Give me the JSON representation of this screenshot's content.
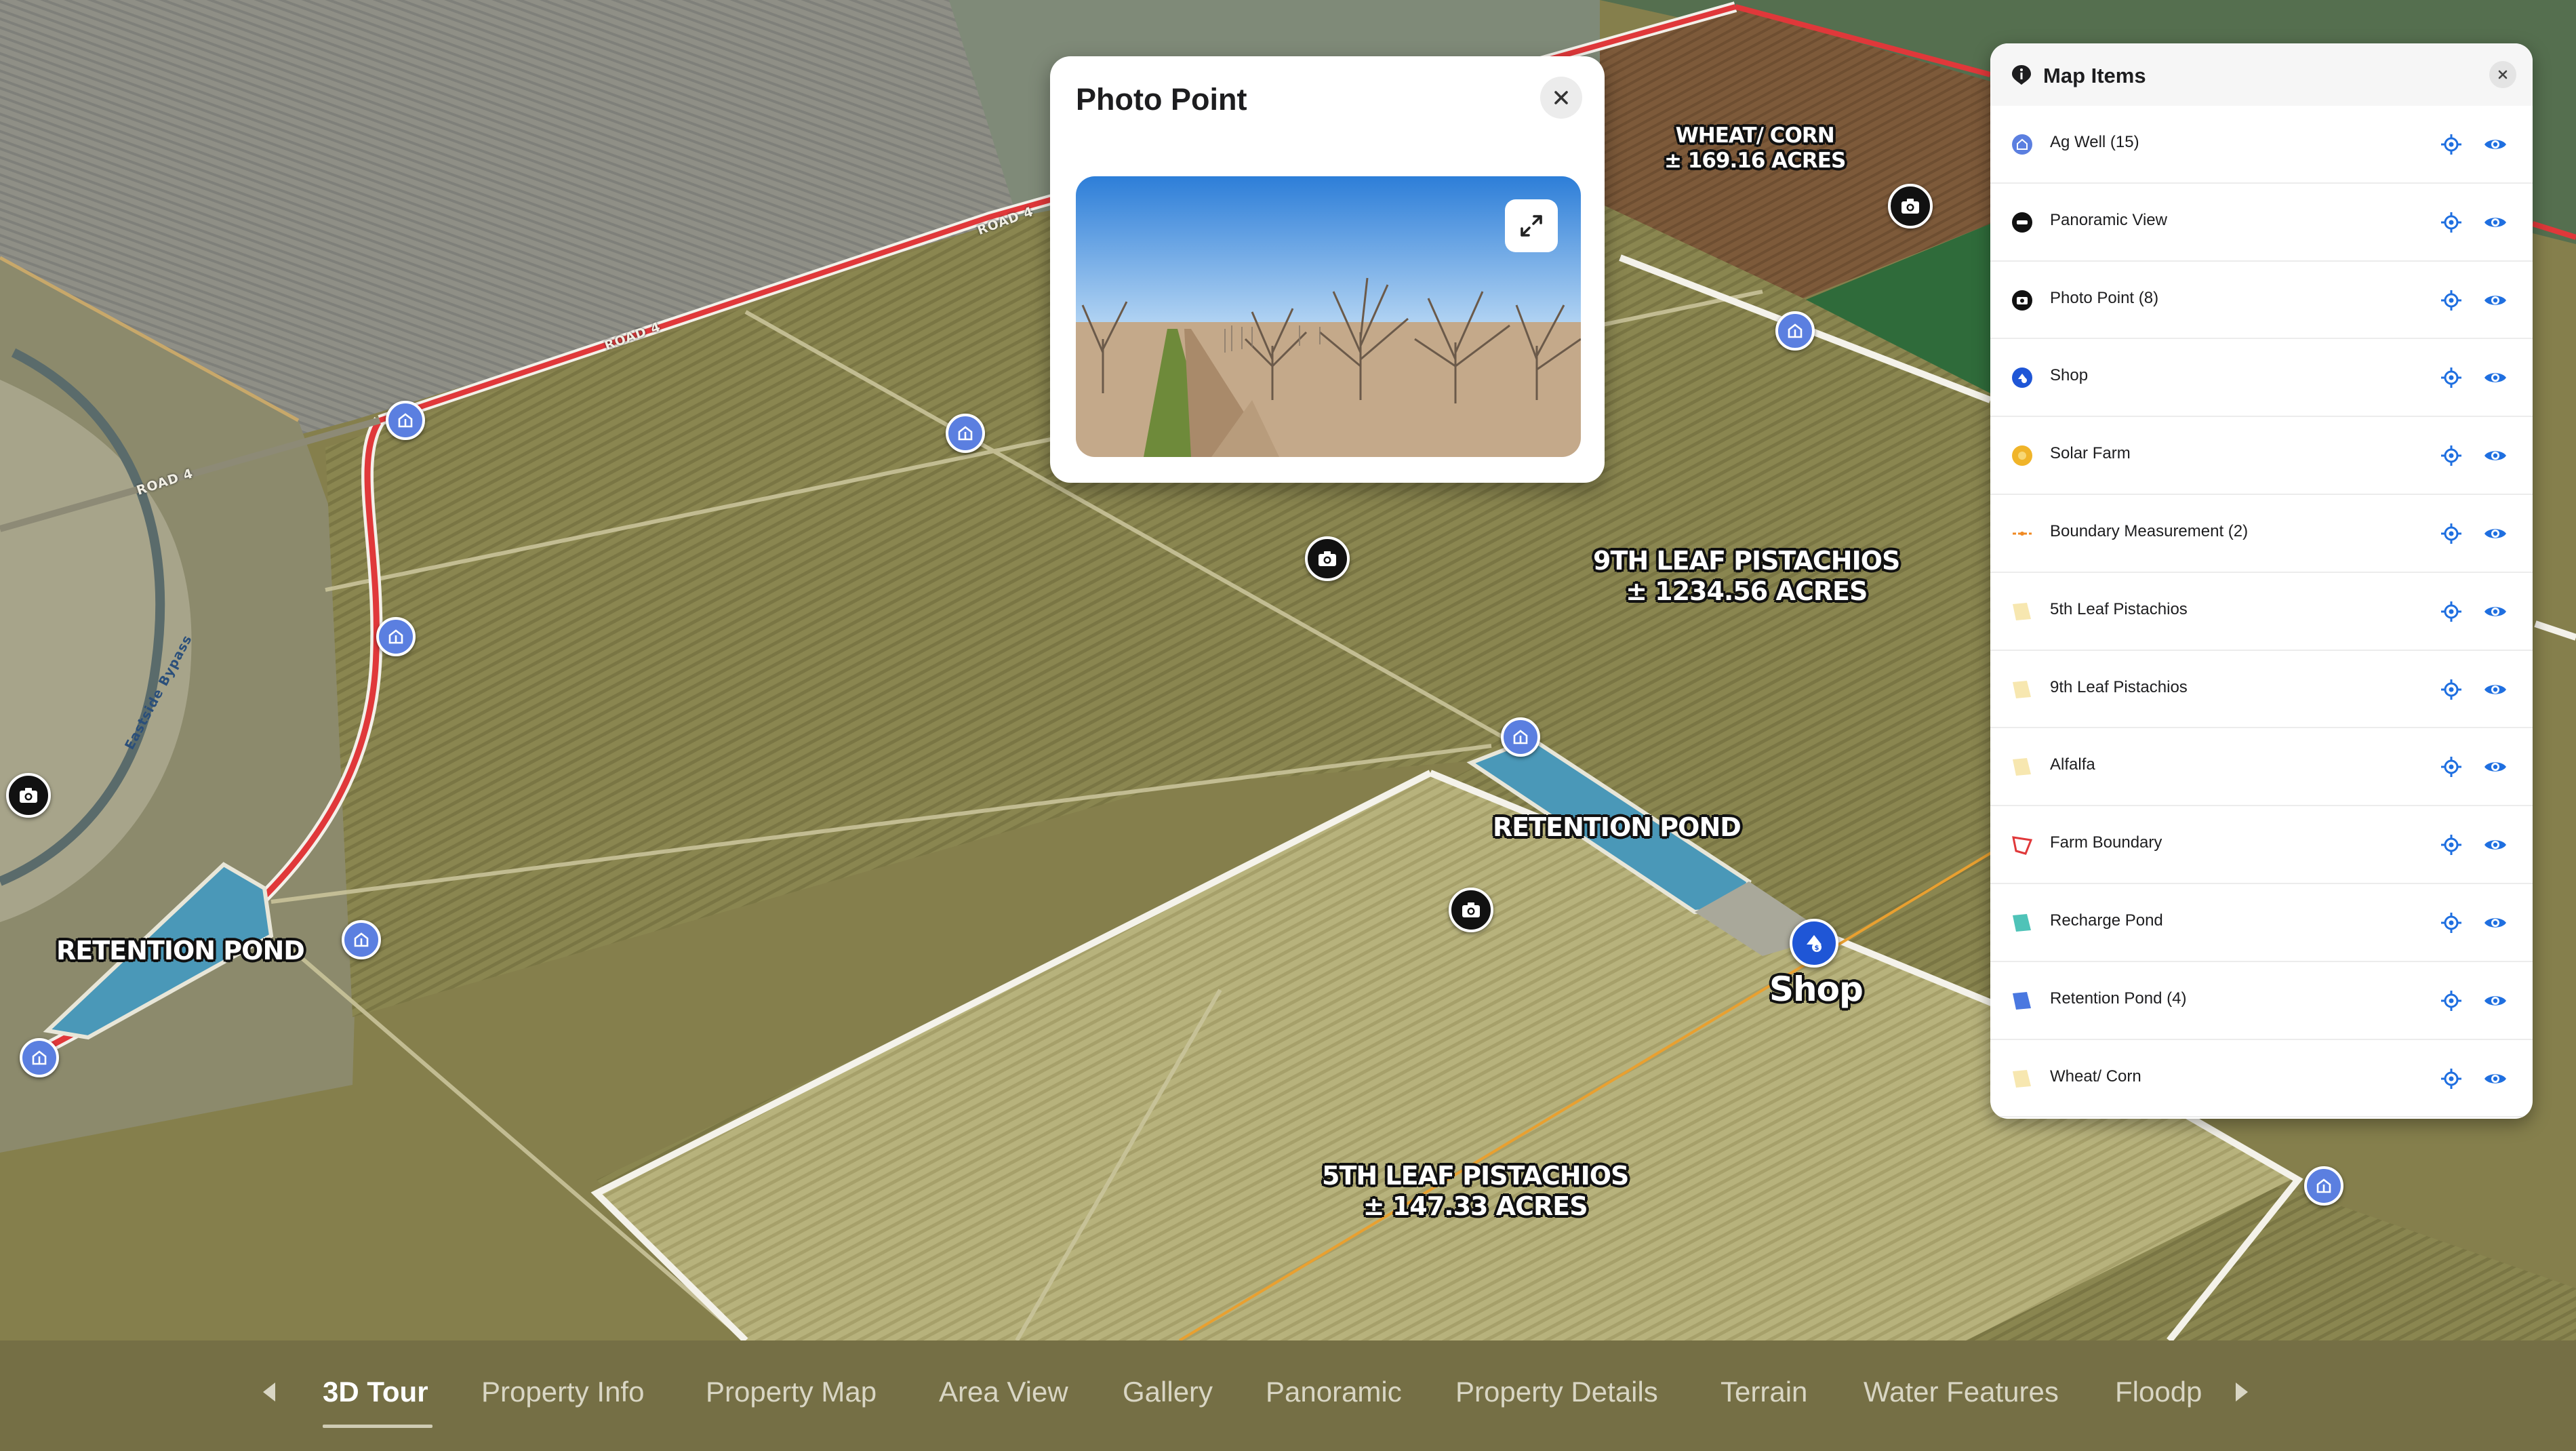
{
  "map": {
    "labels": {
      "wheat_corn_name": "WHEAT/ CORN",
      "wheat_corn_acres": "± 169.16 ACRES",
      "ninth_leaf_name": "9TH LEAF PISTACHIOS",
      "ninth_leaf_acres": "± 1234.56 ACRES",
      "fifth_leaf_name": "5TH LEAF PISTACHIOS",
      "fifth_leaf_acres": "± 147.33 ACRES",
      "retention_pond_center": "RETENTION POND",
      "retention_pond_left": "RETENTION POND",
      "shop": "Shop",
      "road_a": "ROAD 4",
      "road_b": "ROAD 4",
      "road_c": "ROAD 4",
      "bypass": "Eastside Bypass"
    }
  },
  "popup": {
    "title": "Photo Point"
  },
  "panel": {
    "title": "Map Items",
    "items": [
      {
        "label": "Ag Well (15)",
        "icon": "ag-well-icon",
        "color": "#5b7fe0"
      },
      {
        "label": "Panoramic View",
        "icon": "panoramic-icon",
        "color": "#111111"
      },
      {
        "label": "Photo Point (8)",
        "icon": "camera-icon",
        "color": "#111111"
      },
      {
        "label": "Shop",
        "icon": "shop-icon",
        "color": "#1f56d6"
      },
      {
        "label": "Solar Farm",
        "icon": "solar-icon",
        "color": "#f0b429"
      },
      {
        "label": "Boundary Measurement (2)",
        "icon": "measure-icon",
        "color": "#f08a24"
      },
      {
        "label": "5th Leaf Pistachios",
        "icon": "polygon-icon",
        "color": "#f7e7b0"
      },
      {
        "label": "9th Leaf Pistachios",
        "icon": "polygon-icon",
        "color": "#f7e7b0"
      },
      {
        "label": "Alfalfa",
        "icon": "polygon-icon",
        "color": "#f7e7b0"
      },
      {
        "label": "Farm Boundary",
        "icon": "boundary-icon",
        "color": "#e0383a"
      },
      {
        "label": "Recharge Pond",
        "icon": "polygon-icon",
        "color": "#4fc3b8"
      },
      {
        "label": "Retention Pond (4)",
        "icon": "polygon-icon",
        "color": "#4a78e0"
      },
      {
        "label": "Wheat/ Corn",
        "icon": "polygon-icon",
        "color": "#f7e7b0"
      }
    ]
  },
  "nav": {
    "tabs": [
      {
        "label": "3D Tour",
        "active": true
      },
      {
        "label": "Property Info"
      },
      {
        "label": "Property Map"
      },
      {
        "label": "Area View"
      },
      {
        "label": "Gallery"
      },
      {
        "label": "Panoramic"
      },
      {
        "label": "Property Details"
      },
      {
        "label": "Terrain"
      },
      {
        "label": "Water Features"
      },
      {
        "label": "Floodp"
      }
    ]
  },
  "colors": {
    "accent": "#1f56d6",
    "boundary": "#e0383a",
    "well": "#5b7fe0"
  }
}
